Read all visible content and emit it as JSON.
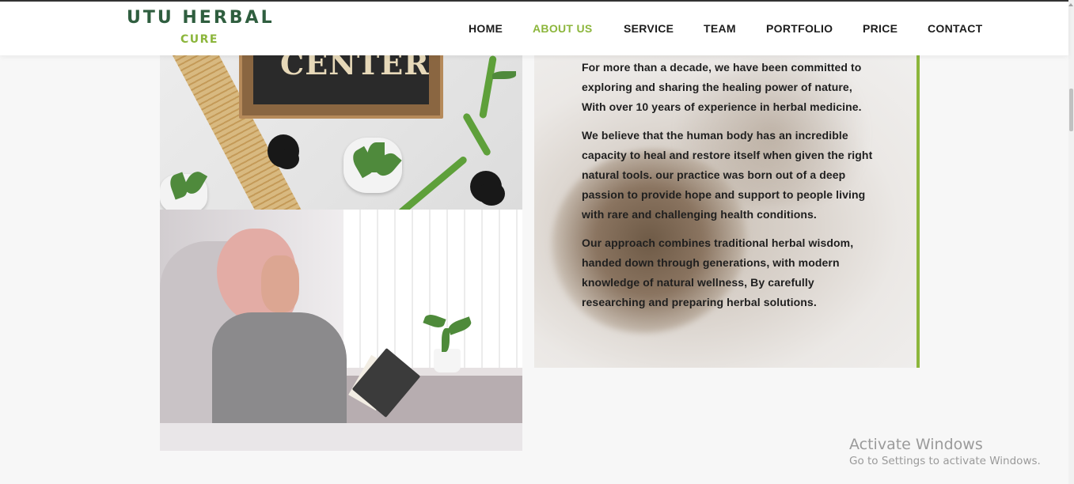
{
  "brand": {
    "name": "UTU HERBAL",
    "tagline": "CURE",
    "primary_color": "#2f5e3f",
    "accent_color": "#8cb63c"
  },
  "nav": {
    "items": [
      {
        "label": "HOME",
        "active": false
      },
      {
        "label": "ABOUT US",
        "active": true
      },
      {
        "label": "SERVICE",
        "active": false
      },
      {
        "label": "TEAM",
        "active": false
      },
      {
        "label": "PORTFOLIO",
        "active": false
      },
      {
        "label": "PRICE",
        "active": false
      },
      {
        "label": "CONTACT",
        "active": false
      }
    ]
  },
  "about": {
    "top_image_sign_text": "CENTER",
    "paragraphs": [
      "For more than a decade, we have been committed to exploring and sharing the healing power of nature, With over 10 years of experience in herbal medicine.",
      "We believe that the human body has an incredible capacity to heal and restore itself when given the right natural tools. our practice was born out of a deep passion to provide hope and support to people living with rare and challenging health conditions.",
      "Our approach combines traditional herbal wisdom, handed down through generations, with modern knowledge of natural wellness, By carefully researching and preparing herbal solutions."
    ]
  },
  "watermark": {
    "title": "Activate Windows",
    "subtitle": "Go to Settings to activate Windows."
  }
}
